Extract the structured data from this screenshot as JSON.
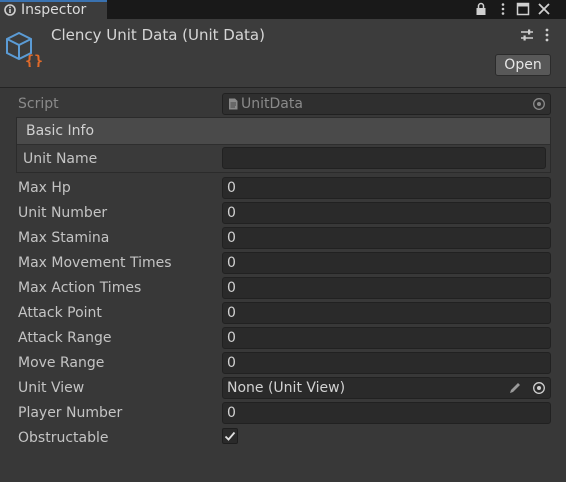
{
  "tab": {
    "title": "Inspector",
    "icon": "inspector-icon"
  },
  "window_controls": [
    "lock-icon",
    "maximize-icon",
    "close-icon"
  ],
  "header": {
    "title": "Clency Unit Data (Unit Data)",
    "asset_icon": "scriptable-object-icon",
    "open_label": "Open",
    "preset_icon": "presets-icon",
    "menu_icon": "kebab-menu-icon"
  },
  "script": {
    "label": "Script",
    "value": "UnitData"
  },
  "basic_info": {
    "header": "Basic Info",
    "unit_name_label": "Unit Name",
    "unit_name_value": ""
  },
  "fields": [
    {
      "label": "Max Hp",
      "value": "0"
    },
    {
      "label": "Unit Number",
      "value": "0"
    },
    {
      "label": "Max Stamina",
      "value": "0"
    },
    {
      "label": "Max Movement Times",
      "value": "0"
    },
    {
      "label": "Max Action Times",
      "value": "0"
    },
    {
      "label": "Attack Point",
      "value": "0"
    },
    {
      "label": "Attack Range",
      "value": "0"
    },
    {
      "label": "Move Range",
      "value": "0"
    }
  ],
  "unit_view": {
    "label": "Unit View",
    "value": "None (Unit View)"
  },
  "player_number": {
    "label": "Player Number",
    "value": "0"
  },
  "obstructable": {
    "label": "Obstructable",
    "checked": true
  },
  "colors": {
    "background": "#383838",
    "field": "#2a2a2a",
    "text": "#c4c4c4",
    "tab_accent": "#3a72b0",
    "icon_blue": "#5b9bd5",
    "icon_orange": "#e06a2a"
  }
}
